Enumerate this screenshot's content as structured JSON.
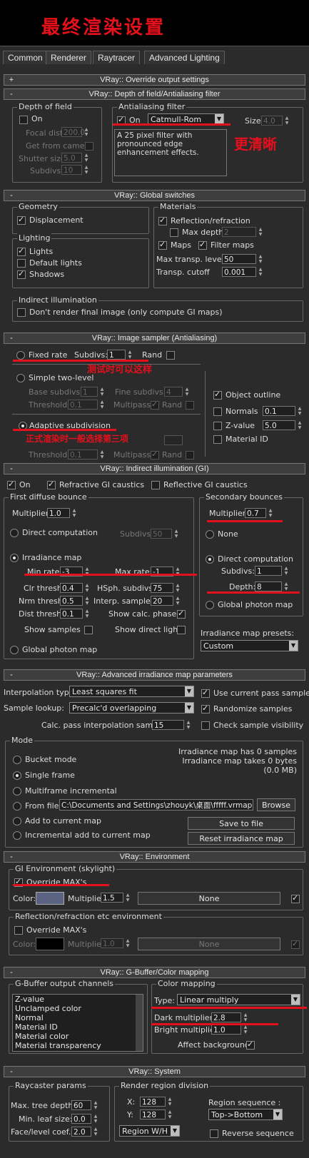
{
  "header": {
    "title_cn": "最终渲染设置"
  },
  "tabs": [
    "Common",
    "Renderer",
    "Raytracer",
    "Advanced Lighting"
  ],
  "rollouts": {
    "override": "VRay:: Override output settings",
    "dof": "VRay:: Depth of field/Antialiasing filter",
    "global": "VRay:: Global switches",
    "sampler": "VRay:: Image sampler (Antialiasing)",
    "gi": "VRay:: Indirect illumination (GI)",
    "adv": "VRay:: Advanced irradiance map parameters",
    "env": "VRay:: Environment",
    "gbuf": "VRay:: G-Buffer/Color mapping",
    "sys": "VRay:: System"
  },
  "dof": {
    "group": "Depth of field",
    "on": "On",
    "focal": "Focal dist",
    "focal_val": "200.0",
    "get_cam": "Get from camera",
    "shutter": "Shutter size",
    "shutter_val": "5.0",
    "subdivs": "Subdivs",
    "subdivs_val": "10",
    "aa_group": "Antialiasing filter",
    "aa_on": "On",
    "filter": "Catmull-Rom",
    "size": "Size:",
    "size_val": "4.0",
    "filter_desc": "A 25 pixel filter with pronounced edge enhancement effects.",
    "note": "更清晰"
  },
  "global": {
    "geometry": "Geometry",
    "displacement": "Displacement",
    "lighting": "Lighting",
    "lights": "Lights",
    "default_lights": "Default lights",
    "shadows": "Shadows",
    "materials": "Materials",
    "reflection": "Reflection/refraction",
    "max_depth": "Max depth",
    "max_depth_val": "2",
    "maps": "Maps",
    "filter_maps": "Filter maps",
    "max_transp": "Max transp. levels",
    "max_transp_val": "50",
    "transp_cutoff": "Transp. cutoff",
    "transp_cutoff_val": "0.001",
    "indirect": "Indirect illumination",
    "dont_render": "Don't render final image (only compute GI maps)"
  },
  "sampler": {
    "fixed": "Fixed rate",
    "subdivs": "Subdivs:",
    "subdivs_val": "1",
    "rand": "Rand",
    "note1": "测试时可以这样",
    "simple": "Simple two-level",
    "base": "Base subdivs:",
    "base_val": "1",
    "fine": "Fine subdivs:",
    "fine_val": "4",
    "threshold": "Threshold",
    "thr_val": "0.1",
    "multipass": "Multipass",
    "rand2": "Rand",
    "adaptive": "Adaptive subdivision",
    "note2": "正式渲染时一般选择第三项",
    "threshold2": "Threshold",
    "thr2_val": "0.1",
    "object_outline": "Object outline",
    "normals": "Normals",
    "normals_val": "0.1",
    "zvalue": "Z-value",
    "zvalue_val": "5.0",
    "material_id": "Material ID"
  },
  "gi": {
    "on": "On",
    "refractive": "Refractive GI caustics",
    "reflective": "Reflective GI caustics",
    "first": "First diffuse bounce",
    "multiplier": "Multiplier:",
    "mult_val": "1.0",
    "direct": "Direct computation",
    "subdivs": "Subdivs",
    "subdivs_val": "50",
    "irradiance": "Irradiance map",
    "min_rate": "Min rate:",
    "min_rate_val": "-3",
    "max_rate": "Max rate:",
    "max_rate_val": "-1",
    "clr_thresh": "Clr thresh:",
    "clr_val": "0.4",
    "hsph": "HSph. subdivs:",
    "hsph_val": "75",
    "nrm_thresh": "Nrm thresh:",
    "nrm_val": "0.5",
    "interp": "Interp. samples:",
    "interp_val": "20",
    "dist_thresh": "Dist thresh:",
    "dist_val": "0.1",
    "show_calc": "Show calc. phase",
    "show_samples": "Show samples",
    "show_direct": "Show direct light",
    "global_photon": "Global photon map",
    "secondary": "Secondary bounces",
    "sec_mult": "Multiplier:",
    "sec_mult_val": "0.7",
    "none": "None",
    "sec_direct": "Direct computation",
    "sec_subdivs": "Subdivs:",
    "sec_subdivs_val": "1",
    "depth": "Depth:",
    "depth_val": "8",
    "sec_photon": "Global photon map",
    "presets": "Irradiance map presets:",
    "preset_val": "Custom"
  },
  "adv": {
    "interp_type": "Interpolation type:",
    "interp_type_val": "Least squares fit",
    "use_current": "Use current pass samples",
    "lookup": "Sample lookup:",
    "lookup_val": "Precalc'd overlapping",
    "randomize": "Randomize samples",
    "calc_pass": "Calc. pass interpolation samples:",
    "calc_pass_val": "15",
    "check_vis": "Check sample visibility",
    "mode": "Mode",
    "bucket": "Bucket mode",
    "single": "Single frame",
    "multiframe": "Multiframe incremental",
    "from_file": "From file:",
    "file_path": "C:\\Documents and Settings\\zhouyk\\桌面\\fffff.vrmap",
    "browse": "Browse",
    "add_current": "Add to current map",
    "incremental": "Incremental add to current map",
    "info1": "Irradiance map has 0 samples",
    "info2": "Irradiance map takes 0 bytes",
    "info3": "(0.0 MB)",
    "save": "Save to file",
    "reset": "Reset irradiance map"
  },
  "env": {
    "gi_env": "GI Environment (skylight)",
    "override": "Override MAX's",
    "color": "Color:",
    "multiplier": "Multiplier:",
    "mult_val": "1.5",
    "none": "None",
    "refl_env": "Reflection/refraction etc environment",
    "override2": "Override MAX's",
    "color2": "Color:",
    "multiplier2": "Multiplier:",
    "mult2_val": "1.0",
    "none2": "None",
    "sky_color": "#5a6482"
  },
  "gbuf": {
    "channels": "G-Buffer output channels",
    "items": [
      "Z-value",
      "Unclamped color",
      "Normal",
      "Material ID",
      "Material color",
      "Material transparency"
    ],
    "color_mapping": "Color mapping",
    "type": "Type:",
    "type_val": "Linear multiply",
    "dark": "Dark multiplier:",
    "dark_val": "2.8",
    "bright": "Bright multiplier:",
    "bright_val": "1.0",
    "affect_bg": "Affect background"
  },
  "sys": {
    "raycaster": "Raycaster params",
    "max_tree": "Max. tree depth:",
    "max_tree_val": "60",
    "min_leaf": "Min. leaf size:",
    "min_leaf_val": "0.0",
    "face_level": "Face/level coef.",
    "face_level_val": "2.0",
    "region_div": "Render region division",
    "x": "X:",
    "x_val": "128",
    "y": "Y:",
    "y_val": "128",
    "region_wh": "Region W/H",
    "region_seq": "Region sequence :",
    "region_seq_val": "Top->Bottom",
    "reverse": "Reverse sequence"
  }
}
